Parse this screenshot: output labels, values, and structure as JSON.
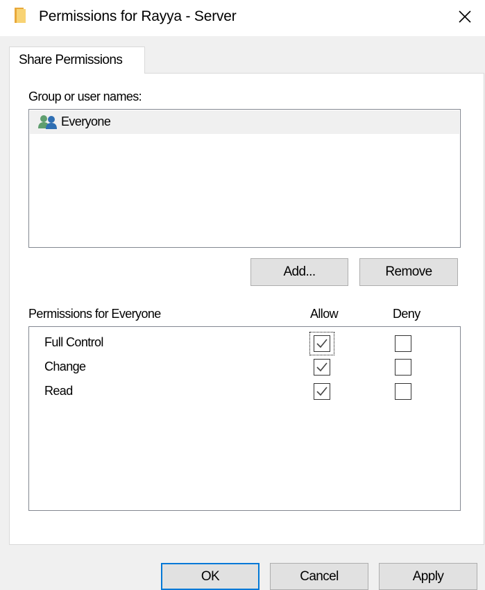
{
  "window": {
    "title": "Permissions for Rayya - Server",
    "close_label": "×"
  },
  "tabs": [
    {
      "label": "Share Permissions",
      "selected": true
    }
  ],
  "users": {
    "label": "Group or user names:",
    "items": [
      {
        "name": "Everyone",
        "icon": "users-icon",
        "selected": true
      }
    ]
  },
  "user_buttons": {
    "add": "Add...",
    "remove": "Remove"
  },
  "permissions": {
    "title": "Permissions for Everyone",
    "col_allow": "Allow",
    "col_deny": "Deny",
    "rows": [
      {
        "name": "Full Control",
        "allow": true,
        "deny": false
      },
      {
        "name": "Change",
        "allow": true,
        "deny": false
      },
      {
        "name": "Read",
        "allow": true,
        "deny": false
      }
    ]
  },
  "footer": {
    "ok": "OK",
    "cancel": "Cancel",
    "apply": "Apply"
  },
  "colors": {
    "accent": "#0078d7",
    "folder": "#f4c04e",
    "check": "#444444"
  }
}
